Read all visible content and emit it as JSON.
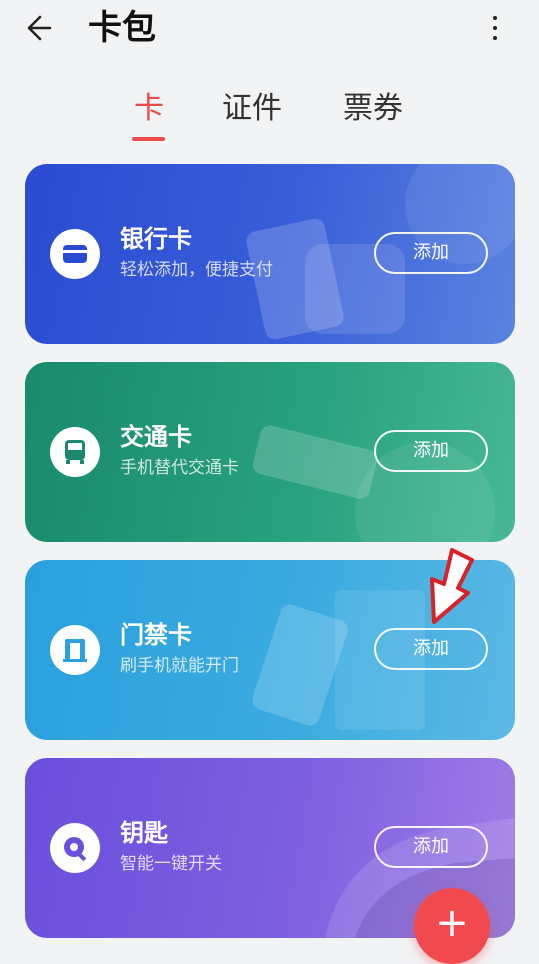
{
  "header": {
    "title": "卡包"
  },
  "tabs": [
    {
      "label": "卡"
    },
    {
      "label": "证件"
    },
    {
      "label": "票券"
    }
  ],
  "cards": [
    {
      "title": "银行卡",
      "subtitle": "轻松添加，便捷支付",
      "button": "添加",
      "color": "#2a4bd1"
    },
    {
      "title": "交通卡",
      "subtitle": "手机替代交通卡",
      "button": "添加",
      "color": "#1a8a6d"
    },
    {
      "title": "门禁卡",
      "subtitle": "刷手机就能开门",
      "button": "添加",
      "color": "#2aa0de"
    },
    {
      "title": "钥匙",
      "subtitle": "智能一键开关",
      "button": "添加",
      "color": "#6b4fdc"
    }
  ],
  "fab": {
    "label": "+"
  },
  "colors": {
    "accent": "#e94a4a",
    "fab": "#f04a4f",
    "background": "#f2f3f5"
  }
}
